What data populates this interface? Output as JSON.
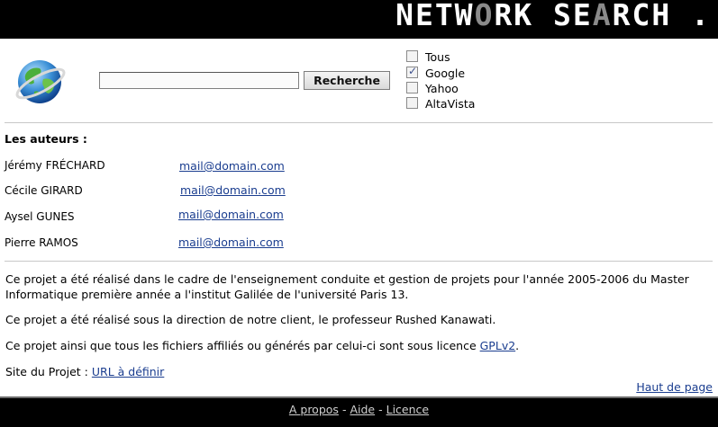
{
  "header": {
    "title_parts": [
      "NETW",
      "O",
      "RK SE",
      "A",
      "RCH ."
    ]
  },
  "search": {
    "input_value": "",
    "button_label": "Recherche",
    "engines": [
      {
        "label": "Tous",
        "checked": false
      },
      {
        "label": "Google",
        "checked": true
      },
      {
        "label": "Yahoo",
        "checked": false
      },
      {
        "label": "AltaVista",
        "checked": false
      }
    ]
  },
  "authors": {
    "title": "Les auteurs :",
    "list": [
      {
        "name": "Jérémy FRÉCHARD",
        "email": "mail@domain.com"
      },
      {
        "name": "Cécile GIRARD",
        "email": "mail@domain.com"
      },
      {
        "name": "Aysel GUNES",
        "email": "mail@domain.com"
      },
      {
        "name": "Pierre RAMOS",
        "email": "mail@domain.com"
      }
    ]
  },
  "content": {
    "para1": "Ce projet a été réalisé dans le cadre de l'enseignement conduite et gestion de projets pour l'année 2005-2006 du Master Informatique première année a l'institut Galilée de l'université Paris 13.",
    "para2": "Ce projet a été réalisé sous la direction de notre client, le professeur Rushed Kanawati.",
    "para3_text": "Ce projet ainsi que tous les fichiers affiliés ou générés par celui-ci sont sous licence ",
    "para3_link": "GPLv2",
    "para3_end": ".",
    "site_label": "Site du Projet : ",
    "site_link": "URL à définir",
    "top_link": "Haut de page"
  },
  "footer": {
    "links": [
      "A propos",
      "Aide",
      "Licence"
    ],
    "separator": "-"
  },
  "colors": {
    "header_bg": "#000000",
    "link": "#1a3d8f",
    "title_highlight": "#8a8a8a"
  }
}
